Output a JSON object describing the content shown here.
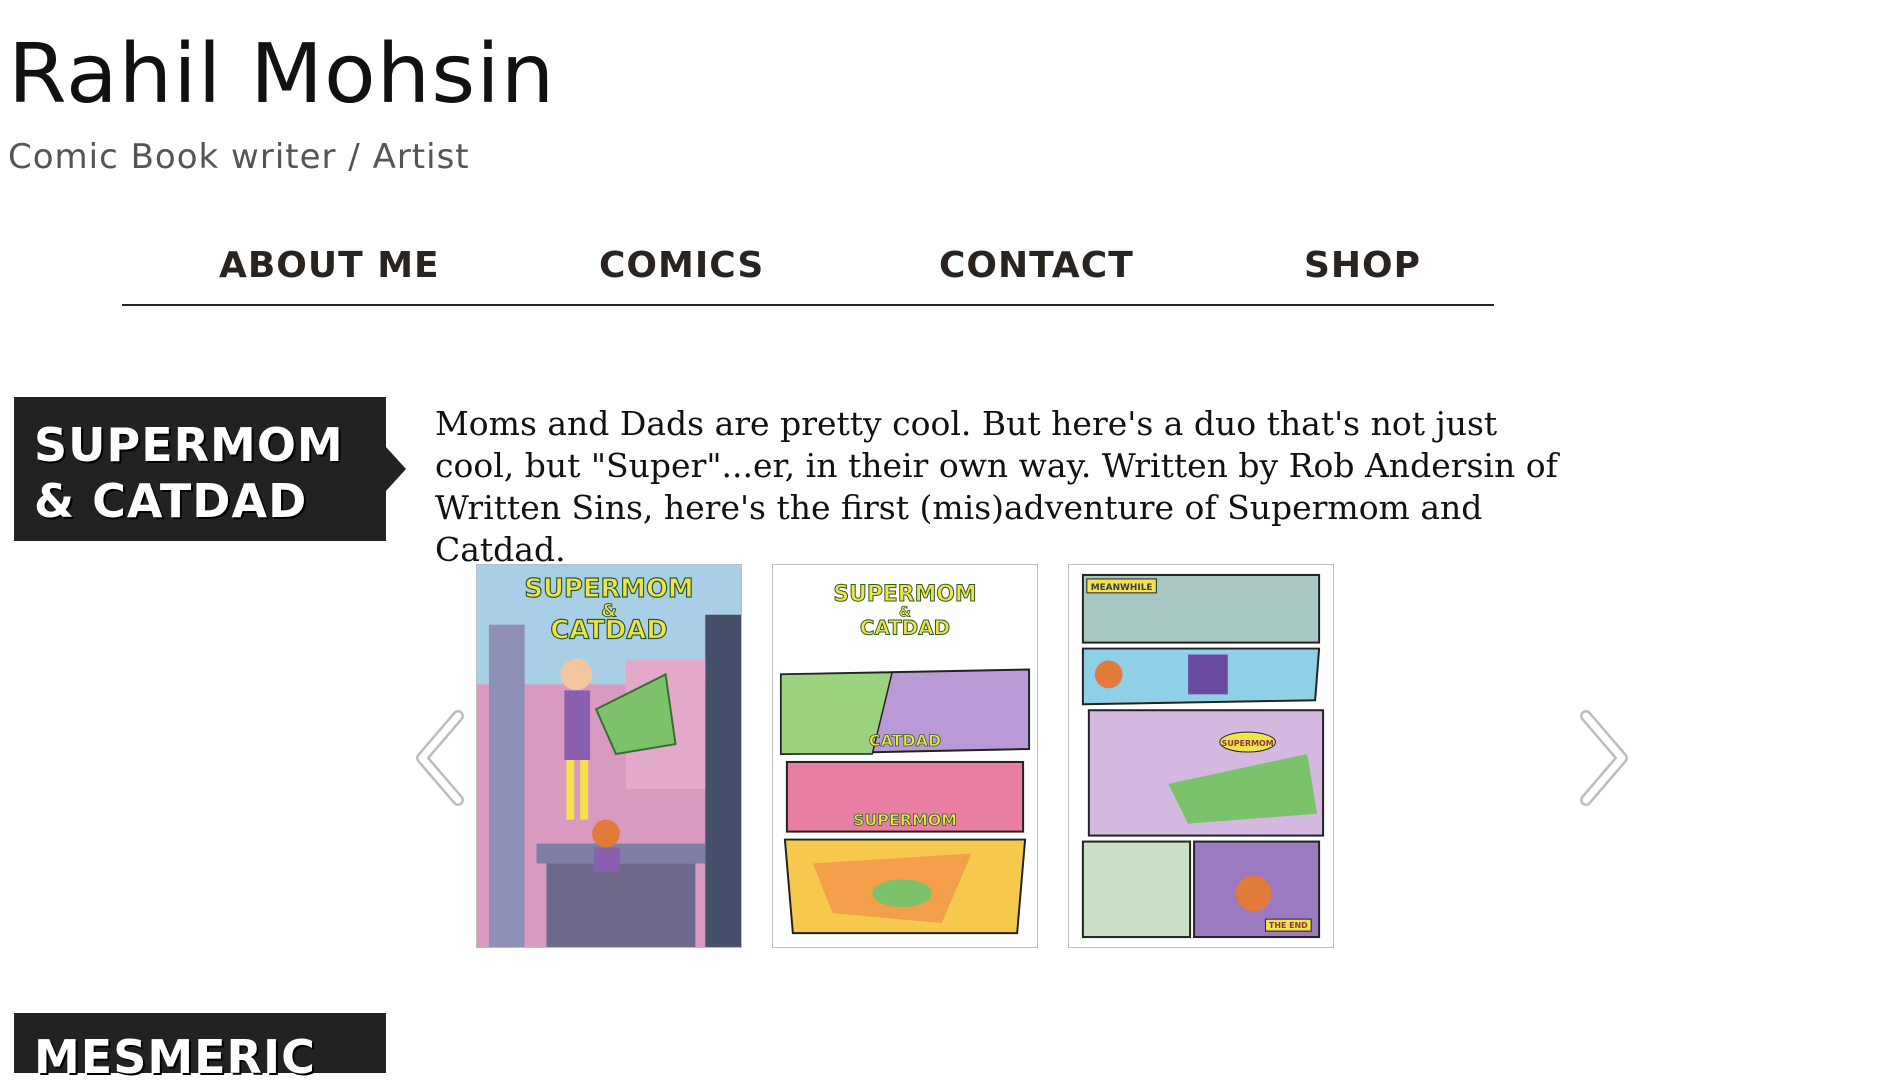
{
  "header": {
    "title": "Rahil Mohsin",
    "subtitle": "Comic Book writer / Artist"
  },
  "nav": {
    "items": [
      {
        "label": "ABOUT ME"
      },
      {
        "label": "COMICS"
      },
      {
        "label": "CONTACT"
      },
      {
        "label": "SHOP"
      }
    ]
  },
  "sections": [
    {
      "label_line1": "SUPERMOM",
      "label_line2": "& CATDAD",
      "description": "Moms and Dads are pretty cool. But here's a duo that's not just cool, but \"Super\"...er, in their own way. Written by Rob Andersin of Written Sins, here's the first (mis)adventure of Supermom and Catdad.",
      "gallery": {
        "prev_icon": "chevron-left-icon",
        "next_icon": "chevron-right-icon",
        "pages": [
          {
            "kind": "cover",
            "title_line1": "SUPERMOM",
            "title_amp": "&",
            "title_line2": "CATDAD"
          },
          {
            "kind": "page",
            "title_line1": "SUPERMOM",
            "title_amp": "&",
            "title_line2": "CATDAD",
            "panel_catdad": "CATDAD",
            "panel_supermom": "SUPERMOM"
          },
          {
            "kind": "page",
            "caption": "MEANWHILE",
            "end_caption": "THE END",
            "sfx": "SUPERMOM"
          }
        ]
      }
    },
    {
      "label_line1": "MESMERIC"
    }
  ],
  "colors": {
    "label_bg": "#222222",
    "nav_text": "#2a2420",
    "comic_yellow": "#f2e34c",
    "comic_green": "#7cc26a",
    "comic_purple": "#8a5fb0",
    "comic_pink": "#e48fb2"
  }
}
